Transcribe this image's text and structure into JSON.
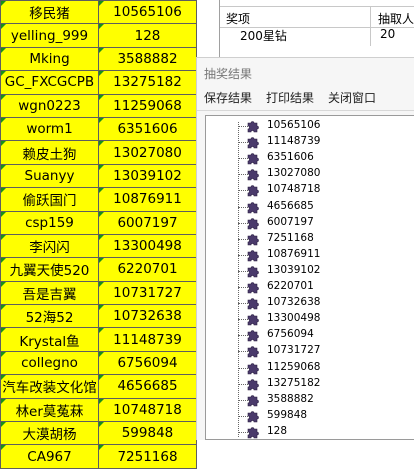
{
  "sheet": {
    "rows": [
      {
        "name": "移民猪",
        "id": "10565106"
      },
      {
        "name": "yelling_999",
        "id": "128"
      },
      {
        "name": "Mking",
        "id": "3588882"
      },
      {
        "name": "GC_FXCGCPB",
        "id": "13275182"
      },
      {
        "name": "wgn0223",
        "id": "11259068"
      },
      {
        "name": "worm1",
        "id": "6351606"
      },
      {
        "name": "赖皮土狗",
        "id": "13027080"
      },
      {
        "name": "Suanyy",
        "id": "13039102"
      },
      {
        "name": "偷跃国门",
        "id": "10876911"
      },
      {
        "name": "csp159",
        "id": "6007197"
      },
      {
        "name": "李闪闪",
        "id": "13300498"
      },
      {
        "name": "九翼天使520",
        "id": "6220701"
      },
      {
        "name": "吾是吉翼",
        "id": "10731727"
      },
      {
        "name": "52海52",
        "id": "10732638"
      },
      {
        "name": "Krystal鱼",
        "id": "11148739"
      },
      {
        "name": "collegno",
        "id": "6756094"
      },
      {
        "name": "汽车改装文化馆",
        "id": "4656685"
      },
      {
        "name": "林er莫菟菻",
        "id": "10748718"
      },
      {
        "name": "大漠胡杨",
        "id": "599848"
      },
      {
        "name": "CA967",
        "id": "7251168"
      }
    ],
    "accent_color": "#ffff00",
    "marker_color": "#1a8f1a"
  },
  "prize_grid": {
    "columns": [
      "奖项",
      "抽取人"
    ],
    "rows": [
      {
        "prize": "200星钻",
        "count": "20"
      }
    ]
  },
  "dialog": {
    "title": "抽奖结果",
    "menu": {
      "save": "保存结果",
      "print": "打印结果",
      "close": "关闭窗口"
    },
    "results": [
      "10565106",
      "11148739",
      "6351606",
      "13027080",
      "10748718",
      "4656685",
      "6007197",
      "7251168",
      "10876911",
      "13039102",
      "6220701",
      "10732638",
      "13300498",
      "6756094",
      "10731727",
      "11259068",
      "13275182",
      "3588882",
      "599848",
      "128"
    ],
    "node_icon": "puzzle-piece-icon",
    "node_icon_color": "#4a3a6b"
  }
}
